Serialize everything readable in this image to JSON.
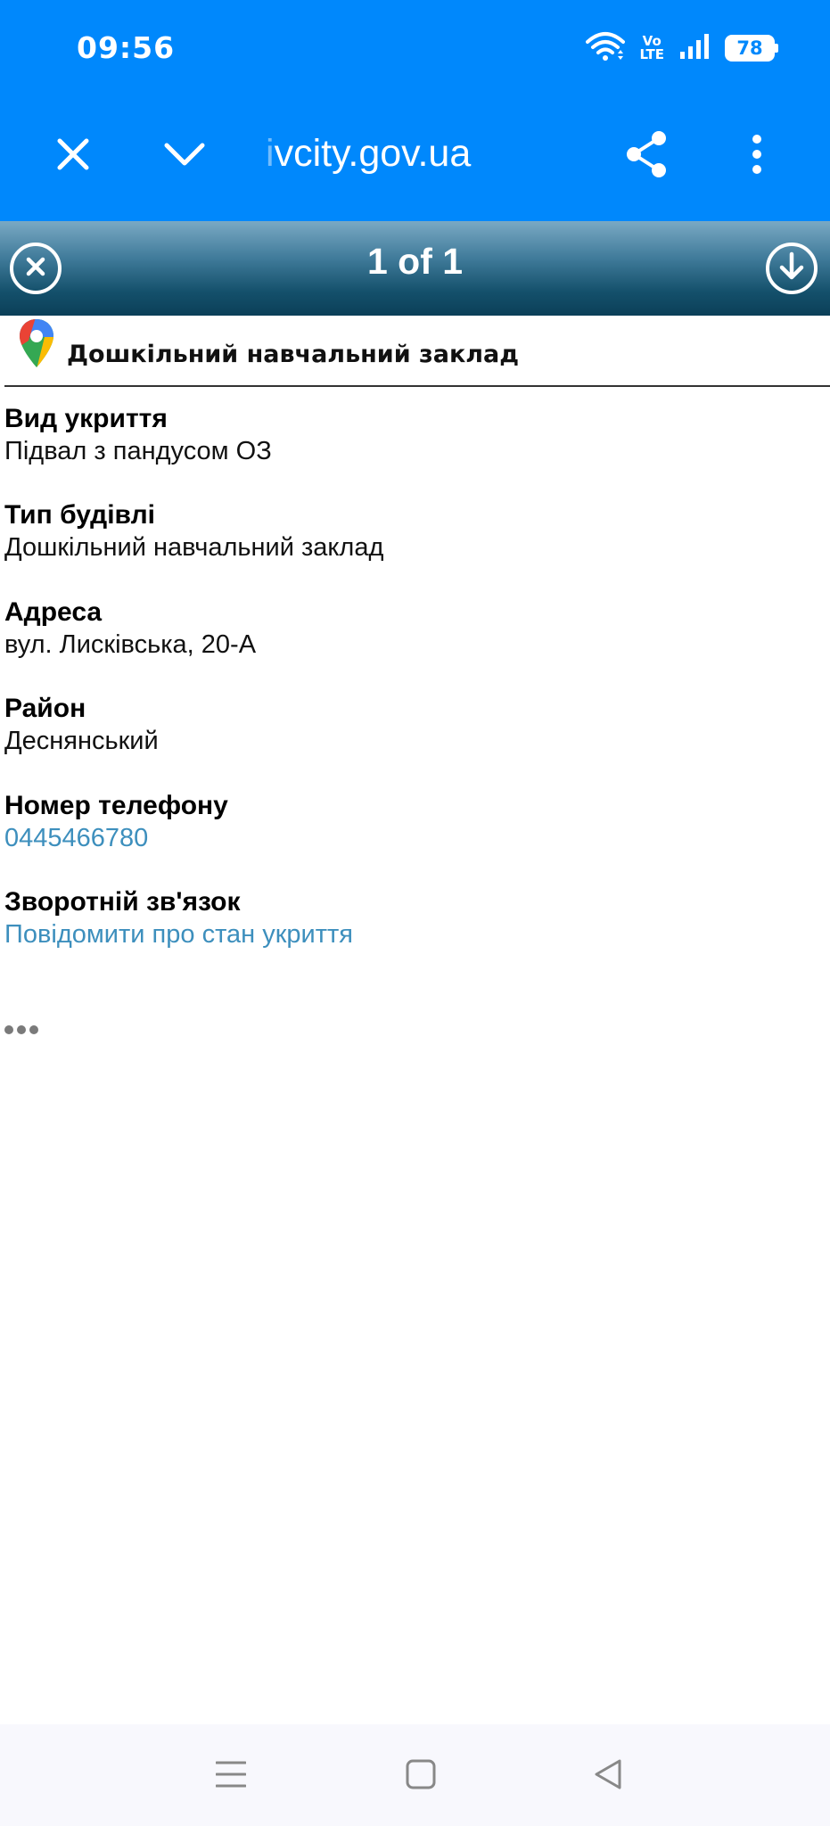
{
  "status_bar": {
    "time": "09:56",
    "network_label_top": "Vo",
    "network_label_bottom": "LTE",
    "battery_level": "78",
    "icons": [
      "wifi-icon",
      "volte-icon",
      "signal-icon",
      "battery-icon"
    ]
  },
  "browser": {
    "url_faded": "i",
    "url_main": "vcity.gov.ua",
    "icons": {
      "close": "close-icon",
      "collapse": "chevron-down-icon",
      "share": "share-icon",
      "menu": "more-vert-icon"
    }
  },
  "result_nav": {
    "count_label": "1 of 1",
    "icons": {
      "close": "close-circle-icon",
      "download": "download-circle-icon"
    }
  },
  "place": {
    "title": "Дошкільний навчальний заклад",
    "icon": "google-maps-pin-icon"
  },
  "fields": [
    {
      "label": "Вид укриття",
      "value": "Підвал з пандусом ОЗ"
    },
    {
      "label": "Тип будівлі",
      "value": "Дошкільний навчальний заклад"
    },
    {
      "label": "Адреса",
      "value": "вул. Лисківська, 20-А"
    },
    {
      "label": "Район",
      "value": "Деснянський"
    },
    {
      "label": "Номер телефону",
      "value": "0445466780"
    },
    {
      "label": "Зворотній зв'язок",
      "value": "Повідомити про стан укриття"
    }
  ],
  "colors": {
    "browser_bar": "#0088fc",
    "link": "#3d8fbd",
    "result_bar_dark": "#0b3f58"
  },
  "system_nav": {
    "icons": [
      "recent-apps-icon",
      "home-icon",
      "back-icon"
    ]
  }
}
